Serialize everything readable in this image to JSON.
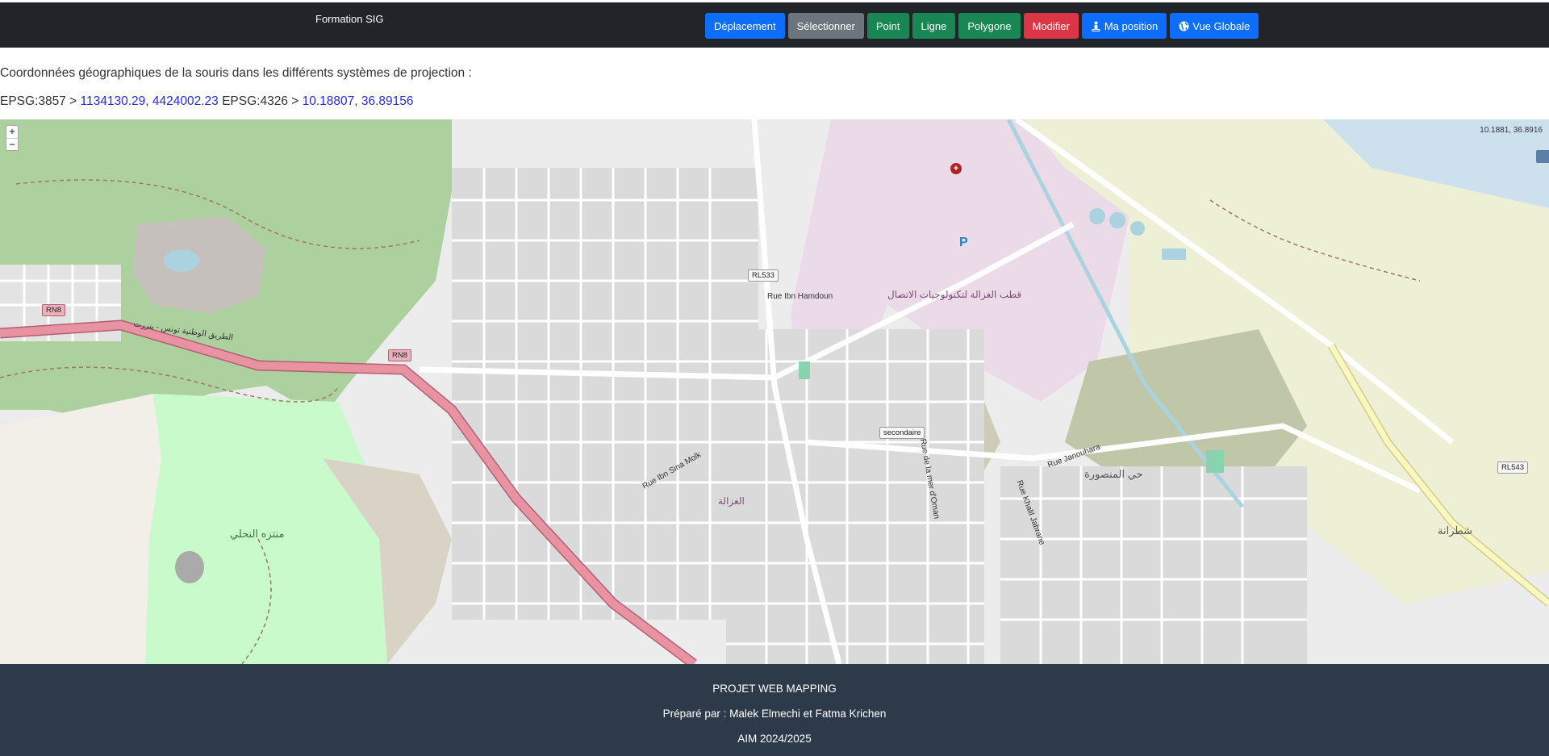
{
  "navbar": {
    "brand": "Formation SIG",
    "buttons": [
      {
        "label": "Déplacement",
        "icon": "",
        "color": "#0d6efd"
      },
      {
        "label": "Sélectionner",
        "icon": "",
        "color": "#6c757d"
      },
      {
        "label": "Point",
        "icon": "",
        "color": "#198754"
      },
      {
        "label": "Ligne",
        "icon": "",
        "color": "#198754"
      },
      {
        "label": "Polygone",
        "icon": "",
        "color": "#198754"
      },
      {
        "label": "Modifier",
        "icon": "",
        "color": "#dc3545"
      },
      {
        "label": "Ma position",
        "icon": "street-view-icon",
        "color": "#0d6efd"
      },
      {
        "label": "Vue Globale",
        "icon": "globe-icon",
        "color": "#0d6efd"
      }
    ]
  },
  "coordinates": {
    "title": "Coordonnées géographiques de la souris dans les différents systèmes de projection :",
    "epsg3857_label": "EPSG:3857 >",
    "epsg3857_value": "1134130.29, 4424002.23",
    "epsg4326_label": "EPSG:4326 >",
    "epsg4326_value": "10.18807, 36.89156"
  },
  "map": {
    "zoom_in": "+",
    "zoom_out": "−",
    "mouse_position": "10.1881, 36.8916",
    "labels": {
      "rl533": "RL533",
      "rn8_a": "RN8",
      "rn8_b": "RN8",
      "rl543": "RL543",
      "secondaire": "secondaire",
      "rue_ibn_hamdoun": "Rue Ibn Hamdoun",
      "rue_ibn_sina": "Rue Ibn Sina Molk",
      "rue_janouhara": "Rue Janouhara",
      "rue_khalil": "Rue Khalil Jabrane",
      "rue_mer_oman": "Rue de la mer d'Oman",
      "route_ar": "الطريق الوطنية تونس - بنزرت",
      "pole_ar": "قطب الغزالة لتكنولوجيات الاتصال",
      "mansoura_ar": "حي المنصورة",
      "ghazala_ar": "الغزالة",
      "nahli_ar": "منتزه النحلي",
      "choutrana_ar": "شطرانة"
    },
    "colors": {
      "background": "#ececec",
      "forest": "#add19e",
      "park": "#c8facc",
      "industrial": "#ebdbe8",
      "farmland": "#eef0d5",
      "trunk_road": "#e892a2",
      "secondary_road": "#f7fabf",
      "water": "#aad3df"
    }
  },
  "footer": {
    "project": "PROJET WEB MAPPING",
    "authors": "Préparé par : Malek Elmechi et Fatma Krichen",
    "year": "AIM 2024/2025"
  }
}
